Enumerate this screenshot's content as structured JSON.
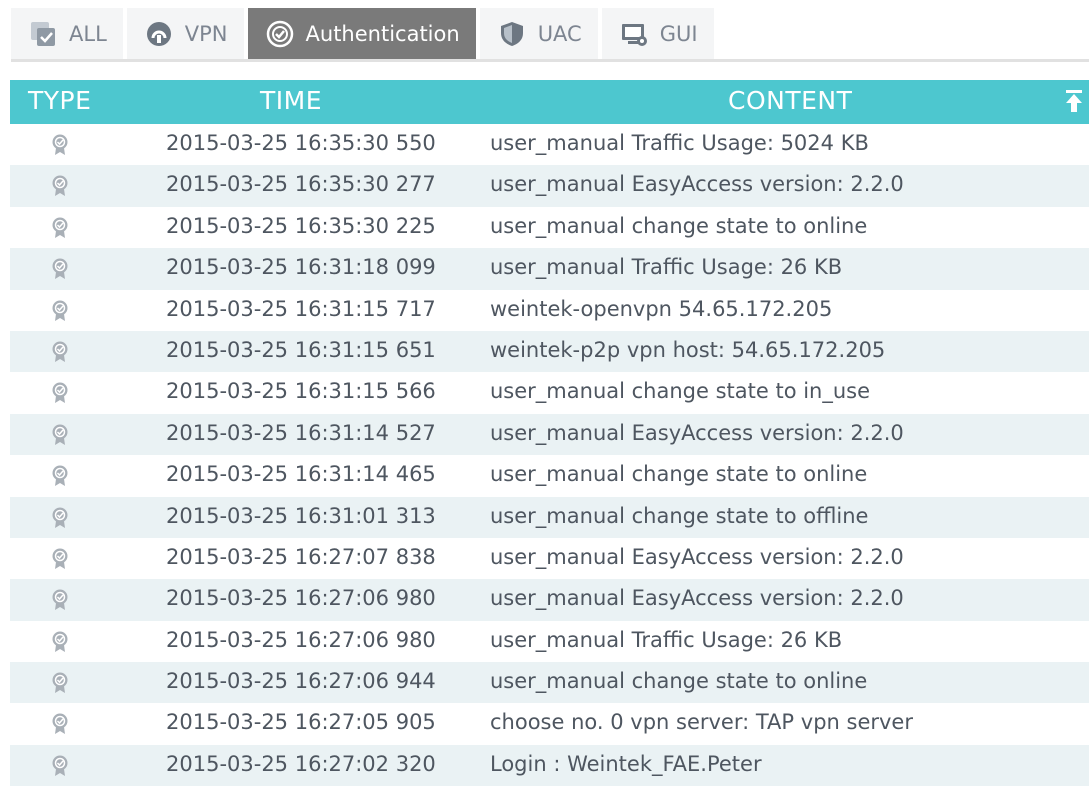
{
  "tabs": [
    {
      "label": "ALL",
      "icon": "all-icon",
      "active": false
    },
    {
      "label": "VPN",
      "icon": "vpn-icon",
      "active": false
    },
    {
      "label": "Authentication",
      "icon": "authentication-icon",
      "active": true
    },
    {
      "label": "UAC",
      "icon": "shield-icon",
      "active": false
    },
    {
      "label": "GUI",
      "icon": "monitor-icon",
      "active": false
    }
  ],
  "table": {
    "headers": {
      "type": "TYPE",
      "time": "TIME",
      "content": "CONTENT"
    },
    "rows": [
      {
        "time": "2015-03-25 16:35:30 550",
        "content": "user_manual Traffic Usage: 5024 KB"
      },
      {
        "time": "2015-03-25 16:35:30 277",
        "content": "user_manual EasyAccess version: 2.2.0"
      },
      {
        "time": "2015-03-25 16:35:30 225",
        "content": "user_manual change state to online"
      },
      {
        "time": "2015-03-25 16:31:18 099",
        "content": "user_manual Traffic Usage: 26 KB"
      },
      {
        "time": "2015-03-25 16:31:15 717",
        "content": "weintek-openvpn 54.65.172.205"
      },
      {
        "time": "2015-03-25 16:31:15 651",
        "content": "weintek-p2p vpn host: 54.65.172.205"
      },
      {
        "time": "2015-03-25 16:31:15 566",
        "content": "user_manual change state to in_use"
      },
      {
        "time": "2015-03-25 16:31:14 527",
        "content": "user_manual EasyAccess version: 2.2.0"
      },
      {
        "time": "2015-03-25 16:31:14 465",
        "content": "user_manual change state to online"
      },
      {
        "time": "2015-03-25 16:31:01 313",
        "content": "user_manual change state to offline"
      },
      {
        "time": "2015-03-25 16:27:07 838",
        "content": "user_manual EasyAccess version: 2.2.0"
      },
      {
        "time": "2015-03-25 16:27:06 980",
        "content": "user_manual EasyAccess version: 2.2.0"
      },
      {
        "time": "2015-03-25 16:27:06 980",
        "content": "user_manual Traffic Usage: 26 KB"
      },
      {
        "time": "2015-03-25 16:27:06 944",
        "content": "user_manual change state to online"
      },
      {
        "time": "2015-03-25 16:27:05 905",
        "content": "choose no. 0 vpn server: TAP vpn server"
      },
      {
        "time": "2015-03-25 16:27:02 320",
        "content": "Login : Weintek_FAE.Peter"
      }
    ]
  },
  "colors": {
    "header_bg": "#4dc7cf",
    "active_tab": "#7a7a7a",
    "stripe": "#eaf2f4"
  }
}
